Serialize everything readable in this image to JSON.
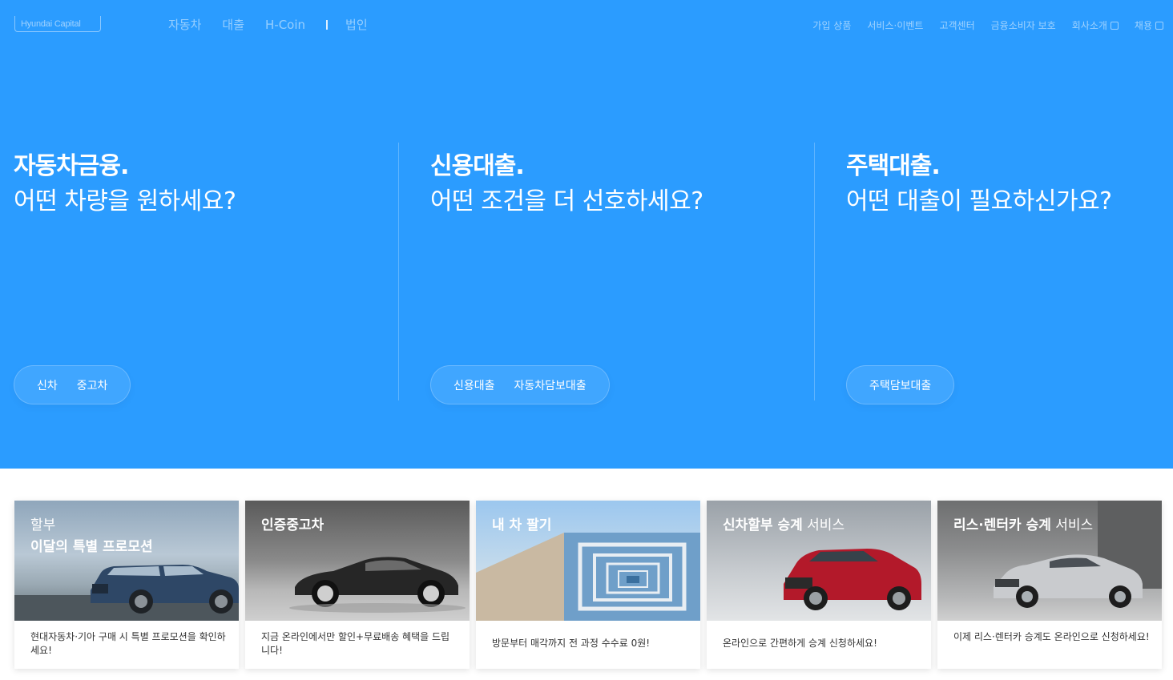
{
  "header": {
    "logo_text": "Hyundai Capital",
    "main_nav": [
      "자동차",
      "대출",
      "H-Coin"
    ],
    "main_nav_after_sep": "법인",
    "util_nav": [
      "가입 상품",
      "서비스·이벤트",
      "고객센터",
      "금융소비자 보호",
      "회사소개",
      "채용"
    ]
  },
  "hero": {
    "columns": [
      {
        "title": "자동차금융.",
        "subtitle": "어떤 차량을 원하세요?",
        "buttons": [
          "신차",
          "중고차"
        ]
      },
      {
        "title": "신용대출.",
        "subtitle": "어떤 조건을 더 선호하세요?",
        "buttons": [
          "신용대출",
          "자동차담보대출"
        ]
      },
      {
        "title": "주택대출.",
        "subtitle": "어떤 대출이 필요하신가요?",
        "buttons": [
          "주택담보대출"
        ]
      }
    ]
  },
  "cards": [
    {
      "title_plain": "할부",
      "title_bold": "이달의 특별 프로모션",
      "desc": "현대자동차·기아 구매 시 특별 프로모션을 확인하세요!"
    },
    {
      "title_bold": "인증중고차",
      "desc": "지금 온라인에서만 할인+무료배송 혜택을 드립니다!"
    },
    {
      "title_bold": "내 차 팔기",
      "desc": "방문부터 매각까지 전 과정 수수료 0원!"
    },
    {
      "title_bold": "신차할부 승계",
      "title_plain": " 서비스",
      "desc": "온라인으로 간편하게 승계 신청하세요!"
    },
    {
      "title_bold": "리스·렌터카 승계",
      "title_plain": " 서비스",
      "desc": "이제 리스·렌터카 승계도 온라인으로 신청하세요!"
    }
  ],
  "colors": {
    "hero_bg": "#2b9cff",
    "card_bg": "#ffffff",
    "text_dark": "#333333"
  },
  "icons": [
    "external-link-icon"
  ]
}
